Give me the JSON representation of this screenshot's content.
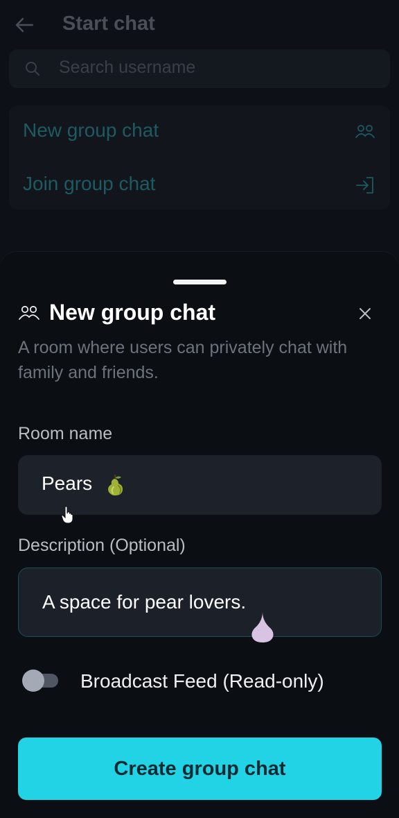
{
  "header": {
    "title": "Start chat"
  },
  "search": {
    "placeholder": "Search username"
  },
  "options": [
    {
      "label": "New group chat",
      "icon": "group-icon"
    },
    {
      "label": "Join group chat",
      "icon": "login-icon"
    }
  ],
  "sheet": {
    "title": "New group chat",
    "description": "A room where users can privately chat with family and friends.",
    "room_name_label": "Room name",
    "room_name_value": "Pears",
    "description_label": "Description (Optional)",
    "description_value": "A space for pear lovers.",
    "broadcast_label": "Broadcast Feed (Read-only)",
    "broadcast_enabled": false,
    "create_button": "Create group chat"
  },
  "colors": {
    "accent": "#22d3e6",
    "sheet_bg": "#0b0e13",
    "field_bg": "#1d212a",
    "muted_text": "#6d737c"
  }
}
